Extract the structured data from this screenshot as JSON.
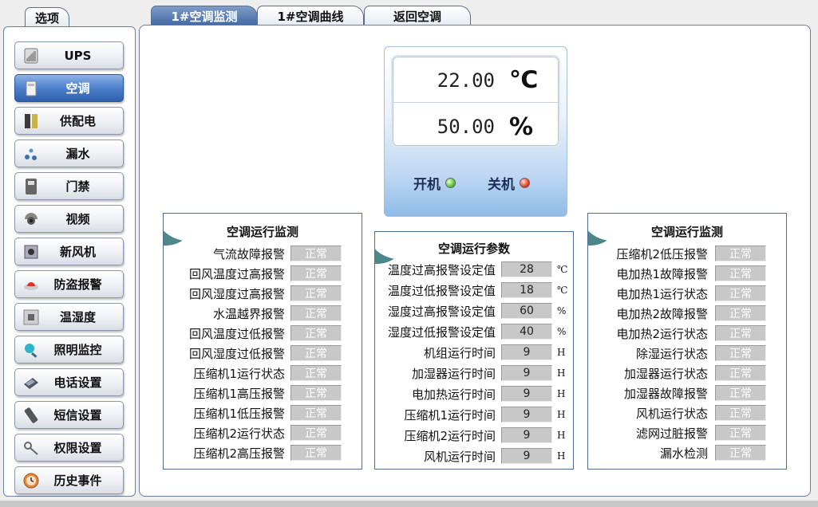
{
  "left_tab": "选项",
  "main_tabs": [
    "1#空调监测",
    "1#空调曲线",
    "返回空调"
  ],
  "sidebar": {
    "items": [
      {
        "label": "UPS",
        "icon": "ups-icon"
      },
      {
        "label": "空调",
        "icon": "air-conditioner-icon",
        "active": true
      },
      {
        "label": "供配电",
        "icon": "power-distribution-icon"
      },
      {
        "label": "漏水",
        "icon": "water-drops-icon"
      },
      {
        "label": "门禁",
        "icon": "access-card-reader-icon"
      },
      {
        "label": "视频",
        "icon": "camera-icon"
      },
      {
        "label": "新风机",
        "icon": "fresh-air-unit-icon"
      },
      {
        "label": "防盗报警",
        "icon": "alarm-light-icon"
      },
      {
        "label": "温湿度",
        "icon": "temp-humidity-sensor-icon"
      },
      {
        "label": "照明监控",
        "icon": "lamp-icon"
      },
      {
        "label": "电话设置",
        "icon": "telephone-icon"
      },
      {
        "label": "短信设置",
        "icon": "mobile-phone-icon"
      },
      {
        "label": "权限设置",
        "icon": "key-icon"
      },
      {
        "label": "历史事件",
        "icon": "clock-icon"
      }
    ]
  },
  "display": {
    "temperature": "22.00",
    "temperature_unit": "℃",
    "humidity": "50.00",
    "humidity_unit": "%",
    "on_label": "开机",
    "off_label": "关机"
  },
  "colors": {
    "accent": "#3f66a5",
    "led_on": "#5cc63a",
    "led_off": "#e8402a",
    "panel_corner": "#4e8789"
  },
  "panel_left": {
    "title": "空调运行监测",
    "rows": [
      {
        "label": "气流故障报警",
        "value": "正常"
      },
      {
        "label": "回风温度过高报警",
        "value": "正常"
      },
      {
        "label": "回风湿度过高报警",
        "value": "正常"
      },
      {
        "label": "水温越界报警",
        "value": "正常"
      },
      {
        "label": "回风温度过低报警",
        "value": "正常"
      },
      {
        "label": "回风湿度过低报警",
        "value": "正常"
      },
      {
        "label": "压缩机1运行状态",
        "value": "正常"
      },
      {
        "label": "压缩机1高压报警",
        "value": "正常"
      },
      {
        "label": "压缩机1低压报警",
        "value": "正常"
      },
      {
        "label": "压缩机2运行状态",
        "value": "正常"
      },
      {
        "label": "压缩机2高压报警",
        "value": "正常"
      }
    ]
  },
  "panel_middle": {
    "title": "空调运行参数",
    "rows": [
      {
        "label": "温度过高报警设定值",
        "value": "28",
        "unit": "℃"
      },
      {
        "label": "温度过低报警设定值",
        "value": "18",
        "unit": "℃"
      },
      {
        "label": "湿度过高报警设定值",
        "value": "60",
        "unit": "%"
      },
      {
        "label": "湿度过低报警设定值",
        "value": "40",
        "unit": "%"
      },
      {
        "label": "机组运行时间",
        "value": "9",
        "unit": "H"
      },
      {
        "label": "加湿器运行时间",
        "value": "9",
        "unit": "H"
      },
      {
        "label": "电加热运行时间",
        "value": "9",
        "unit": "H"
      },
      {
        "label": "压缩机1运行时间",
        "value": "9",
        "unit": "H"
      },
      {
        "label": "压缩机2运行时间",
        "value": "9",
        "unit": "H"
      },
      {
        "label": "风机运行时间",
        "value": "9",
        "unit": "H"
      }
    ]
  },
  "panel_right": {
    "title": "空调运行监测",
    "rows": [
      {
        "label": "压缩机2低压报警",
        "value": "正常"
      },
      {
        "label": "电加热1故障报警",
        "value": "正常"
      },
      {
        "label": "电加热1运行状态",
        "value": "正常"
      },
      {
        "label": "电加热2故障报警",
        "value": "正常"
      },
      {
        "label": "电加热2运行状态",
        "value": "正常"
      },
      {
        "label": "除湿运行状态",
        "value": "正常"
      },
      {
        "label": "加湿器运行状态",
        "value": "正常"
      },
      {
        "label": "加湿器故障报警",
        "value": "正常"
      },
      {
        "label": "风机运行状态",
        "value": "正常"
      },
      {
        "label": "滤网过脏报警",
        "value": "正常"
      },
      {
        "label": "漏水检测",
        "value": "正常"
      }
    ]
  }
}
